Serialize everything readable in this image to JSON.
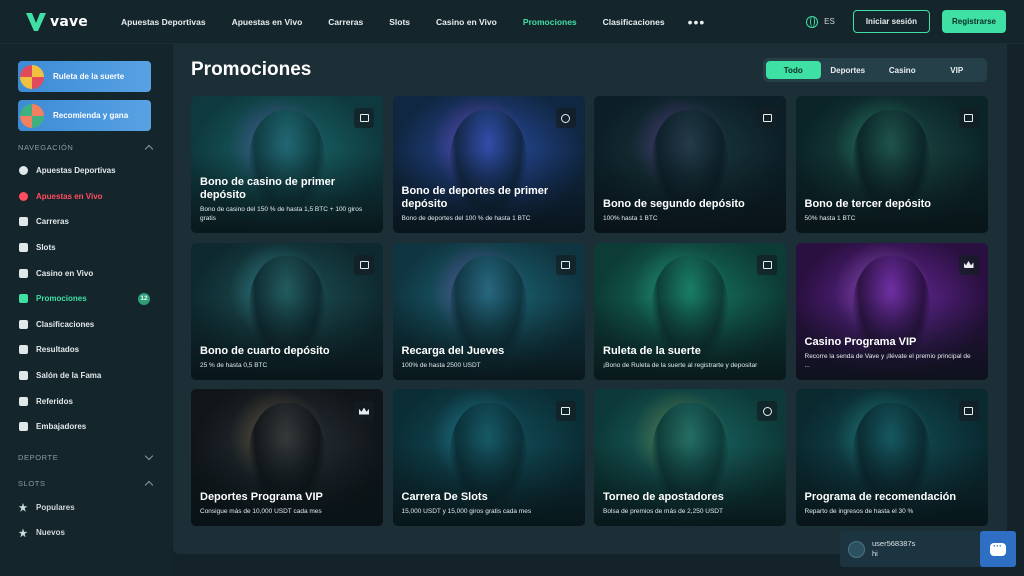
{
  "brand": {
    "name": "vave",
    "accent": "#3ee0a4"
  },
  "nav": {
    "items": [
      {
        "label": "Apuestas Deportivas",
        "active": false
      },
      {
        "label": "Apuestas en Vivo",
        "active": false
      },
      {
        "label": "Carreras",
        "active": false
      },
      {
        "label": "Slots",
        "active": false
      },
      {
        "label": "Casino en Vivo",
        "active": false
      },
      {
        "label": "Promociones",
        "active": true
      },
      {
        "label": "Clasificaciones",
        "active": false
      }
    ],
    "more": "•••"
  },
  "header": {
    "lang": "ES",
    "login_label": "Iniciar sesión",
    "register_label": "Registrarse"
  },
  "sidebar": {
    "promos": [
      {
        "label": "Ruleta de la suerte",
        "icon": "wheel-icon"
      },
      {
        "label": "Recomienda y gana",
        "icon": "referral-icon"
      }
    ],
    "nav_section": "NAVEGACIÓN",
    "items": [
      {
        "label": "Apuestas Deportivas",
        "icon": "soccer-ball-icon",
        "style": "normal"
      },
      {
        "label": "Apuestas en Vivo",
        "icon": "live-icon",
        "style": "red"
      },
      {
        "label": "Carreras",
        "icon": "horse-icon",
        "style": "normal"
      },
      {
        "label": "Slots",
        "icon": "slots-icon",
        "style": "normal"
      },
      {
        "label": "Casino en Vivo",
        "icon": "cards-icon",
        "style": "normal"
      },
      {
        "label": "Promociones",
        "icon": "gift-icon",
        "style": "green",
        "badge": "12"
      },
      {
        "label": "Clasificaciones",
        "icon": "leaderboard-icon",
        "style": "normal"
      },
      {
        "label": "Resultados",
        "icon": "flag-icon",
        "style": "normal"
      },
      {
        "label": "Salón de la Fama",
        "icon": "trophy-icon",
        "style": "normal"
      },
      {
        "label": "Referidos",
        "icon": "gift-box-icon",
        "style": "normal"
      },
      {
        "label": "Embajadores",
        "icon": "handshake-icon",
        "style": "normal"
      }
    ],
    "deporte_section": "DEPORTE",
    "slots_section": "SLOTS",
    "slots_items": [
      {
        "label": "Populares",
        "icon": "crown-icon"
      },
      {
        "label": "Nuevos",
        "icon": "star-icon"
      }
    ]
  },
  "main": {
    "title": "Promociones",
    "filters": [
      {
        "label": "Todo",
        "active": true
      },
      {
        "label": "Deportes",
        "active": false
      },
      {
        "label": "Casino",
        "active": false
      },
      {
        "label": "VIP",
        "active": false
      }
    ],
    "cards": [
      {
        "title": "Bono de casino de primer depósito",
        "desc": "Bono de casino del 150 % de hasta 1,5 BTC + 100 giros gratis",
        "cat": "casino",
        "bg1": "#0e3a3f",
        "bg2": "#1a6a6c",
        "glow": "#b04cff"
      },
      {
        "title": "Bono de deportes de primer depósito",
        "desc": "Bono de deportes del 100 % de hasta 1 BTC",
        "cat": "sport",
        "bg1": "#102742",
        "bg2": "#2a4ea8",
        "glow": "#e14cff"
      },
      {
        "title": "Bono de segundo depósito",
        "desc": "100% hasta 1 BTC",
        "cat": "casino",
        "bg1": "#0c1f27",
        "bg2": "#1b3a40",
        "glow": "#c04cff"
      },
      {
        "title": "Bono de tercer depósito",
        "desc": "50% hasta 1 BTC",
        "cat": "casino",
        "bg1": "#0b2428",
        "bg2": "#1d4c46",
        "glow": "#3ee0a4"
      },
      {
        "title": "Bono de cuarto depósito",
        "desc": "25 % de hasta 0,5 BTC",
        "cat": "casino",
        "bg1": "#0e2a30",
        "bg2": "#1f5456",
        "glow": "#5fe8ff"
      },
      {
        "title": "Recarga del Jueves",
        "desc": "100% de hasta 2500 USDT",
        "cat": "casino",
        "bg1": "#0f3540",
        "bg2": "#1d6a7a",
        "glow": "#e14cff"
      },
      {
        "title": "Ruleta de la suerte",
        "desc": "¡Bono de Ruleta de la suerte al registrarte y depositar",
        "cat": "casino",
        "bg1": "#0d3b36",
        "bg2": "#177a64",
        "glow": "#3ee0a4"
      },
      {
        "title": "Casino Programa VIP",
        "desc": "Recorre la senda de Vave y ¡llévate el premio principal de ...",
        "cat": "vip",
        "bg1": "#2a1040",
        "bg2": "#6a2aa0",
        "glow": "#d79cff"
      },
      {
        "title": "Deportes Programa VIP",
        "desc": "Consigue más de 10,000 USDT cada mes",
        "cat": "vip",
        "bg1": "#101519",
        "bg2": "#2b3338",
        "glow": "#e0b060"
      },
      {
        "title": "Carrera De Slots",
        "desc": "15,000 USDT y 15,000 giros gratis cada mes",
        "cat": "casino",
        "bg1": "#0b2e36",
        "bg2": "#13535f",
        "glow": "#3fd0f0"
      },
      {
        "title": "Torneo de apostadores",
        "desc": "Bolsa de premios de más de 2,250 USDT",
        "cat": "sport",
        "bg1": "#0d3a38",
        "bg2": "#1a6a66",
        "glow": "#e8c040"
      },
      {
        "title": "Programa de recomendación",
        "desc": "Reparto de ingresos de hasta el 30 %",
        "cat": "casino",
        "bg1": "#0a2a30",
        "bg2": "#14505a",
        "glow": "#3ee0c4"
      }
    ]
  },
  "chat": {
    "user": "user568387s",
    "message": "hi"
  }
}
